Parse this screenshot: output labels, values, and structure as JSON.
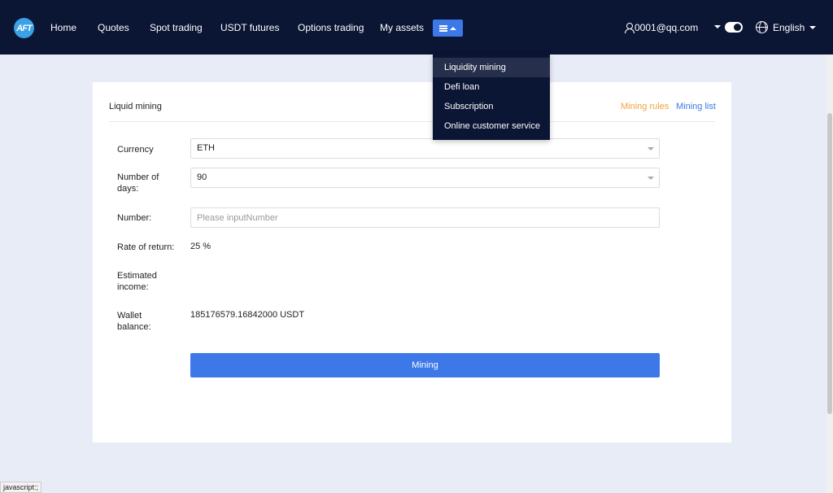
{
  "header": {
    "logo_text": "AFT",
    "nav": [
      "Home",
      "Quotes",
      "Spot trading",
      "USDT futures",
      "Options trading",
      "My assets"
    ],
    "more_icon": "list-icon",
    "user_email": "0001@qq.com",
    "language": "English"
  },
  "dropdown": {
    "items": [
      "Liquidity mining",
      "Defi loan",
      "Subscription",
      "Online customer service"
    ],
    "active_index": 0
  },
  "card": {
    "title": "Liquid mining",
    "rules_link": "Mining rules",
    "list_link": "Mining list"
  },
  "form": {
    "currency_label": "Currency",
    "currency_value": "ETH",
    "days_label": "Number of days:",
    "days_value": "90",
    "number_label": "Number:",
    "number_placeholder": "Please inputNumber",
    "rate_label": "Rate of return:",
    "rate_value": "25 %",
    "income_label": "Estimated income:",
    "income_value": "",
    "wallet_label": "Wallet balance:",
    "wallet_value": "185176579.16842000 USDT",
    "submit_label": "Mining"
  },
  "status_bar": "javascript:;",
  "colors": {
    "header_bg": "#0b1534",
    "accent": "#3d78e8",
    "rules_link": "#f0a23b"
  }
}
